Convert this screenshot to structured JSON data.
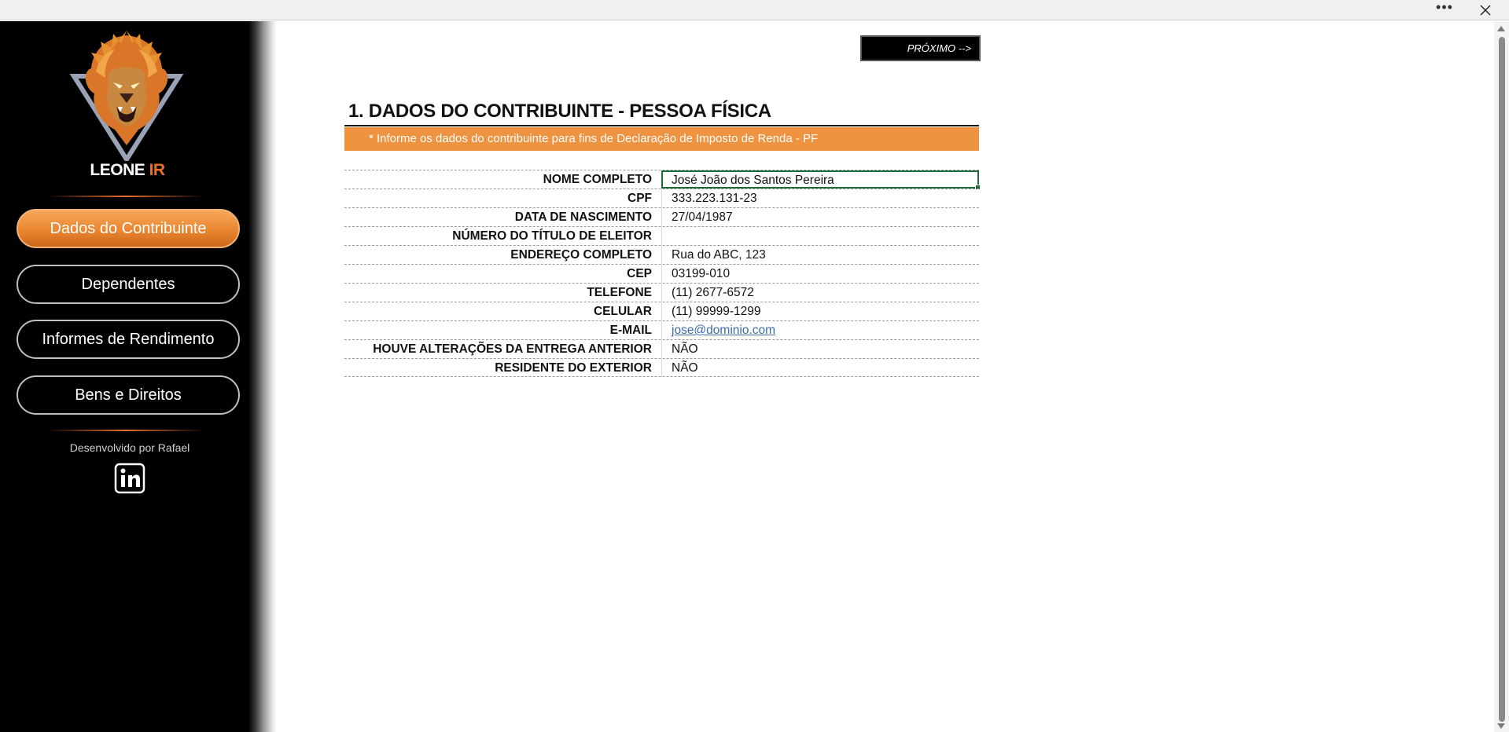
{
  "window": {
    "more_label": "•••",
    "close_icon": "close-icon"
  },
  "sidebar": {
    "brand_main": "LEONE",
    "brand_accent": "IR",
    "accent_color": "#e8702a",
    "nav": [
      {
        "label": "Dados do Contribuinte",
        "active": true
      },
      {
        "label": "Dependentes",
        "active": false
      },
      {
        "label": "Informes de Rendimento",
        "active": false
      },
      {
        "label": "Bens e Direitos",
        "active": false
      }
    ],
    "developer": "Desenvolvido por Rafael",
    "social_icon": "linkedin-icon"
  },
  "main": {
    "next_label": "PRÓXIMO -->",
    "title": "1. DADOS DO CONTRIBUINTE - PESSOA FÍSICA",
    "banner": "* Informe os dados do contribuinte para fins de Declaração de Imposto de Renda - PF",
    "banner_color": "#ee9340",
    "fields": [
      {
        "label": "NOME COMPLETO",
        "value": "José João dos Santos Pereira"
      },
      {
        "label": "CPF",
        "value": "333.223.131-23"
      },
      {
        "label": "DATA DE NASCIMENTO",
        "value": "27/04/1987"
      },
      {
        "label": "NÚMERO DO TÍTULO DE ELEITOR",
        "value": ""
      },
      {
        "label": "ENDEREÇO COMPLETO",
        "value": "Rua do ABC, 123"
      },
      {
        "label": "CEP",
        "value": "03199-010"
      },
      {
        "label": "TELEFONE",
        "value": "(11) 2677-6572"
      },
      {
        "label": "CELULAR",
        "value": "(11) 99999-1299"
      },
      {
        "label": "E-MAIL",
        "value": "jose@dominio.com"
      },
      {
        "label": "HOUVE ALTERAÇÕES DA ENTREGA ANTERIOR",
        "value": "NÃO"
      },
      {
        "label": "RESIDENTE DO EXTERIOR",
        "value": "NÃO"
      }
    ]
  }
}
